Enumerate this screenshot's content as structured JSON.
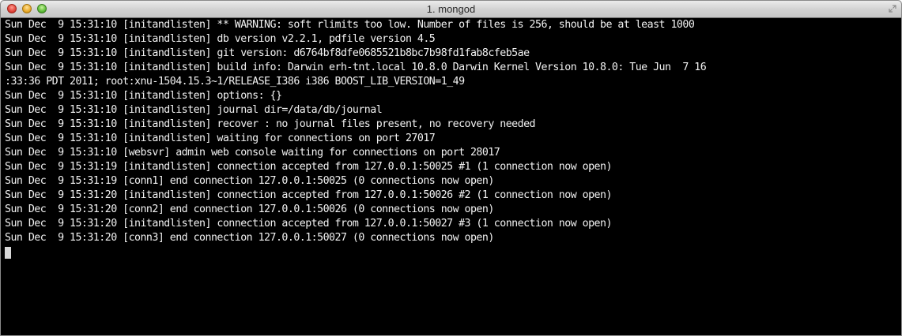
{
  "window": {
    "title": "1. mongod"
  },
  "terminal": {
    "lines": [
      "Sun Dec  9 15:31:10 [initandlisten] ** WARNING: soft rlimits too low. Number of files is 256, should be at least 1000",
      "Sun Dec  9 15:31:10 [initandlisten] db version v2.2.1, pdfile version 4.5",
      "Sun Dec  9 15:31:10 [initandlisten] git version: d6764bf8dfe0685521b8bc7b98fd1fab8cfeb5ae",
      "Sun Dec  9 15:31:10 [initandlisten] build info: Darwin erh-tnt.local 10.8.0 Darwin Kernel Version 10.8.0: Tue Jun  7 16",
      ":33:36 PDT 2011; root:xnu-1504.15.3~1/RELEASE_I386 i386 BOOST_LIB_VERSION=1_49",
      "Sun Dec  9 15:31:10 [initandlisten] options: {}",
      "Sun Dec  9 15:31:10 [initandlisten] journal dir=/data/db/journal",
      "Sun Dec  9 15:31:10 [initandlisten] recover : no journal files present, no recovery needed",
      "Sun Dec  9 15:31:10 [initandlisten] waiting for connections on port 27017",
      "Sun Dec  9 15:31:10 [websvr] admin web console waiting for connections on port 28017",
      "Sun Dec  9 15:31:19 [initandlisten] connection accepted from 127.0.0.1:50025 #1 (1 connection now open)",
      "Sun Dec  9 15:31:19 [conn1] end connection 127.0.0.1:50025 (0 connections now open)",
      "Sun Dec  9 15:31:20 [initandlisten] connection accepted from 127.0.0.1:50026 #2 (1 connection now open)",
      "Sun Dec  9 15:31:20 [conn2] end connection 127.0.0.1:50026 (0 connections now open)",
      "Sun Dec  9 15:31:20 [initandlisten] connection accepted from 127.0.0.1:50027 #3 (1 connection now open)",
      "Sun Dec  9 15:31:20 [conn3] end connection 127.0.0.1:50027 (0 connections now open)"
    ]
  },
  "icons": {
    "close": "close-button-icon",
    "minimize": "minimize-button-icon",
    "zoom": "zoom-button-icon",
    "resize": "fullscreen-icon"
  },
  "colors": {
    "terminal_background": "#000000",
    "terminal_text": "#f2f2f2",
    "cursor": "#d8d8d8"
  }
}
